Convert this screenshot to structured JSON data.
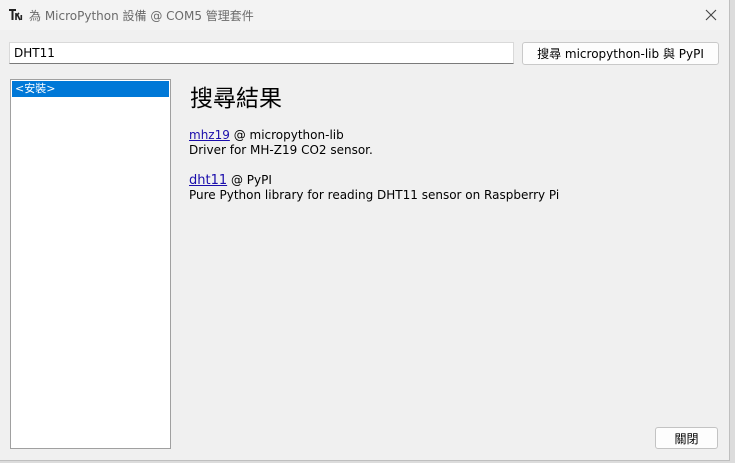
{
  "window": {
    "title": "為 MicroPython 設備 @ COM5 管理套件"
  },
  "search": {
    "value": "DHT11",
    "button_label": "搜尋 micropython-lib 與 PyPI"
  },
  "sidebar": {
    "items": [
      {
        "label": "<安裝>",
        "selected": true
      }
    ]
  },
  "main": {
    "title": "搜尋結果",
    "results": [
      {
        "name": "mhz19",
        "source": " @ micropython-lib",
        "description": "Driver for MH-Z19 CO2 sensor."
      },
      {
        "name": "dht11",
        "source": " @ PyPI",
        "description": "Pure Python library for reading DHT11 sensor on Raspberry Pi"
      }
    ]
  },
  "footer": {
    "close_label": "關閉"
  },
  "colors": {
    "selection": "#0078d7",
    "link": "#1a0dab",
    "background": "#f0f0f0"
  },
  "icons": {
    "app": "thonny-app-icon",
    "close": "close-icon"
  }
}
